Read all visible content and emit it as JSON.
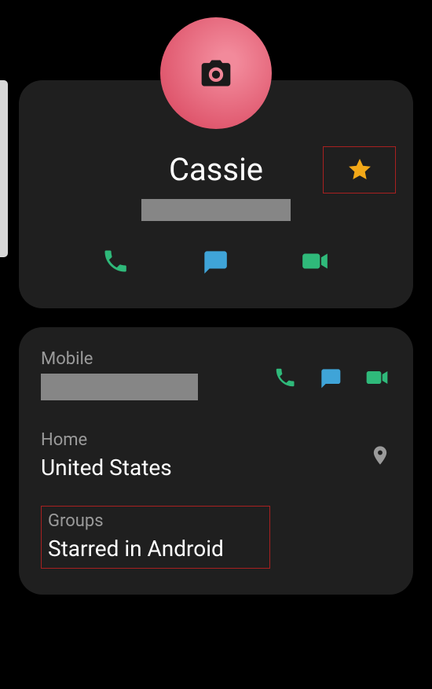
{
  "contact": {
    "name": "Cassie"
  },
  "fields": {
    "mobile_label": "Mobile",
    "home_label": "Home",
    "home_value": "United States",
    "groups_label": "Groups",
    "groups_value": "Starred in Android"
  },
  "colors": {
    "call": "#2fb97a",
    "message": "#3fa4d8",
    "video": "#2fb97a",
    "star": "#f2a818",
    "pin": "#9a9a9a"
  }
}
